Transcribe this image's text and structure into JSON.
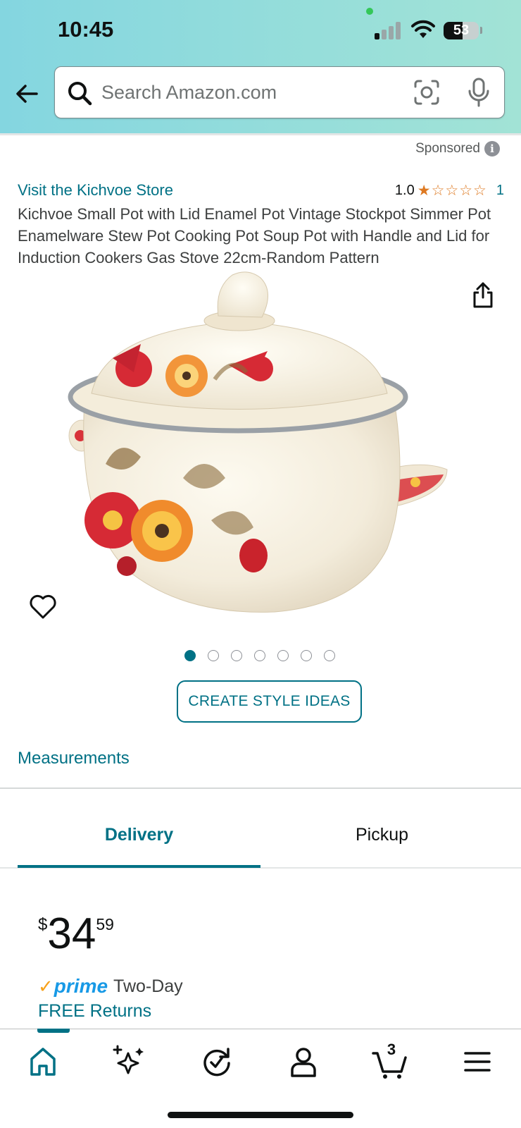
{
  "status_bar": {
    "time": "10:45",
    "battery": "53",
    "battery_level": 0.53
  },
  "search": {
    "placeholder": "Search Amazon.com"
  },
  "product": {
    "sponsored": "Sponsored",
    "store_link": "Visit the Kichvoe Store",
    "rating_value": "1.0",
    "rating_stars": 1,
    "rating_count": "1",
    "title": "Kichvoe Small Pot with Lid Enamel Pot Vintage Stockpot Simmer Pot Enamelware Stew Pot Cooking Pot Soup Pot with Handle and Lid for Induction Cookers Gas Stove 22cm-Random Pattern",
    "image_count": 7,
    "image_index": 1,
    "style_button": "CREATE STYLE IDEAS",
    "measurements_link": "Measurements"
  },
  "tabs": {
    "delivery": "Delivery",
    "pickup": "Pickup"
  },
  "pricing": {
    "currency_symbol": "$",
    "whole": "34",
    "fraction": "59",
    "prime_label": "prime",
    "prime_speed": "Two-Day",
    "free_returns": "FREE Returns"
  },
  "bottom_nav": {
    "items": [
      "home-icon",
      "ai-sparkle-icon",
      "history-icon",
      "account-icon",
      "cart-icon",
      "menu-icon"
    ],
    "cart_count": "3"
  },
  "colors": {
    "link": "#007185",
    "star": "#de7921",
    "prime_blue": "#1799e6",
    "prime_check": "#f7a11a",
    "header_start": "#84d6e0",
    "header_end": "#a2e3d6"
  }
}
